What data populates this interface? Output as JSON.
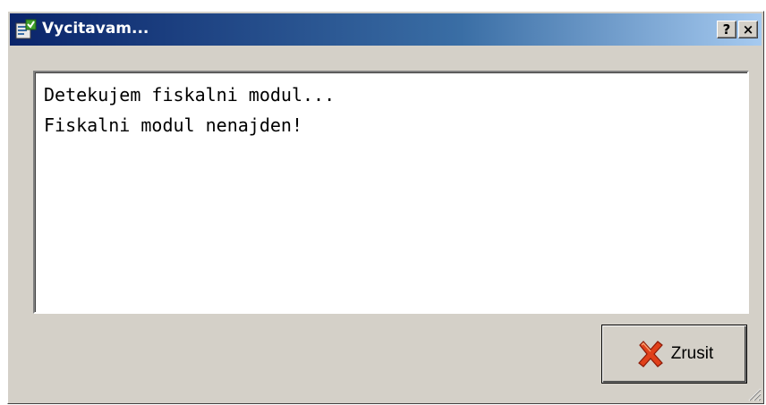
{
  "window": {
    "title": "Vycitavam...",
    "help_label": "?",
    "close_label": "×"
  },
  "log": {
    "lines": [
      "Detekujem fiskalni modul...",
      "Fiskalni modul nenajden!"
    ]
  },
  "buttons": {
    "cancel_label": "Zrusit"
  },
  "colors": {
    "titlebar_start": "#0a246a",
    "titlebar_end": "#a6caf0",
    "face": "#d4d0c8",
    "cancel_icon": "#e0401a"
  }
}
